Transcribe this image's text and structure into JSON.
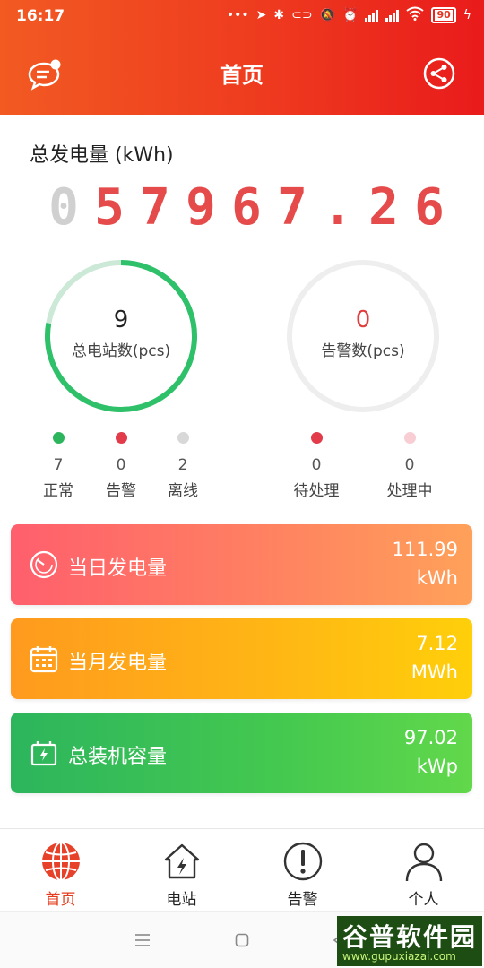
{
  "status_bar": {
    "time": "16:17",
    "battery": "90"
  },
  "header": {
    "title": "首页"
  },
  "summary": {
    "title": "总发电量 (kWh)",
    "digits": [
      "0",
      "5",
      "7",
      "9",
      "6",
      "7",
      ".",
      "2",
      "6"
    ]
  },
  "stations": {
    "count": "9",
    "label": "总电站数(pcs)",
    "legend": [
      {
        "count": "7",
        "label": "正常",
        "color": "#2db55d"
      },
      {
        "count": "0",
        "label": "告警",
        "color": "#e23c4b"
      },
      {
        "count": "2",
        "label": "离线",
        "color": "#d8d8d8"
      }
    ],
    "ring_progress": {
      "normal": 7,
      "offline": 2,
      "total": 9
    }
  },
  "alarms": {
    "count": "0",
    "label": "告警数(pcs)",
    "legend": [
      {
        "count": "0",
        "label": "待处理",
        "color": "#e23c4b"
      },
      {
        "count": "0",
        "label": "处理中",
        "color": "#f8cdd4"
      }
    ]
  },
  "cards": [
    {
      "label": "当日发电量",
      "value": "111.99",
      "unit": "kWh",
      "icon": "gauge-icon"
    },
    {
      "label": "当月发电量",
      "value": "7.12",
      "unit": "MWh",
      "icon": "calendar-icon"
    },
    {
      "label": "总装机容量",
      "value": "97.02",
      "unit": "kWp",
      "icon": "battery-icon"
    }
  ],
  "bottom_nav": [
    {
      "label": "首页",
      "icon": "globe-icon",
      "active": true
    },
    {
      "label": "电站",
      "icon": "house-bolt-icon"
    },
    {
      "label": "告警",
      "icon": "alert-icon"
    },
    {
      "label": "个人",
      "icon": "person-icon"
    }
  ],
  "watermark": {
    "main": "谷普软件园",
    "url": "www.gupuxiazai.com"
  }
}
